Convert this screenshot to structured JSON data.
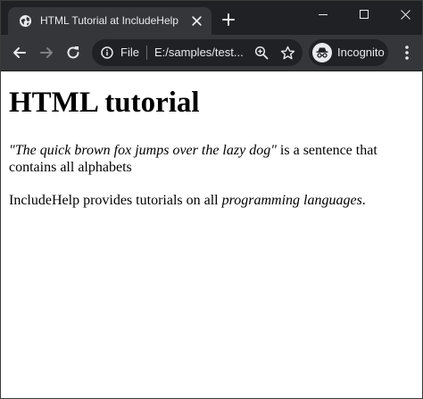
{
  "tab": {
    "title": "HTML Tutorial at IncludeHelp"
  },
  "omnibox": {
    "scheme_label": "File",
    "url": "E:/samples/test..."
  },
  "profile": {
    "label": "Incognito"
  },
  "content": {
    "heading": "HTML tutorial",
    "para1_quote": "\"The quick brown fox jumps over the lazy dog\"",
    "para1_rest": " is a sentence that contains all alphabets",
    "para2_start": "IncludeHelp provides tutorials on all ",
    "para2_emphasis": "programming languages",
    "para2_end": "."
  },
  "colors": {
    "titlebar": "#202124",
    "toolbar": "#35363a",
    "omnibox": "#202124",
    "chrome_text": "#e8eaed",
    "page_bg": "#ffffff",
    "page_text": "#000000"
  },
  "icons": {
    "tab_favicon": "globe-icon",
    "tab_close": "close-icon",
    "new_tab": "plus-icon",
    "minimize": "minimize-icon",
    "maximize": "maximize-icon",
    "window_close": "close-icon",
    "back": "arrow-left-icon",
    "forward": "arrow-right-icon",
    "reload": "reload-icon",
    "site_info": "info-icon",
    "zoom": "zoom-icon",
    "bookmark": "star-icon",
    "incognito": "incognito-icon",
    "menu": "kebab-menu-icon"
  }
}
